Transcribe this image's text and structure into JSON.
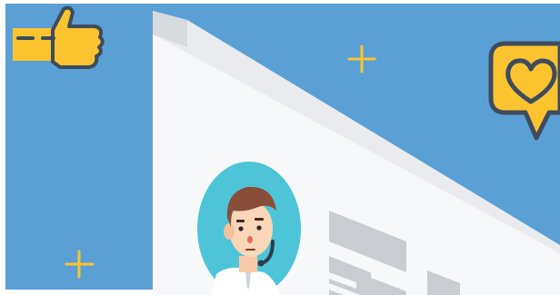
{
  "illustration": {
    "icons": [
      "thumbs-up-icon",
      "heart-speech-bubble-icon",
      "plus-icon",
      "plus-icon",
      "user-avatar-icon"
    ]
  },
  "colors": {
    "background": "#5aa0d4",
    "accent_yellow": "#fbc42e",
    "icon_outline": "#3f4b5e",
    "page_white": "#f7f8f9",
    "page_back": "#e7e9ec",
    "avatar_ring": "#4ec4d8",
    "placeholder_gray": "#c9cdd1"
  }
}
